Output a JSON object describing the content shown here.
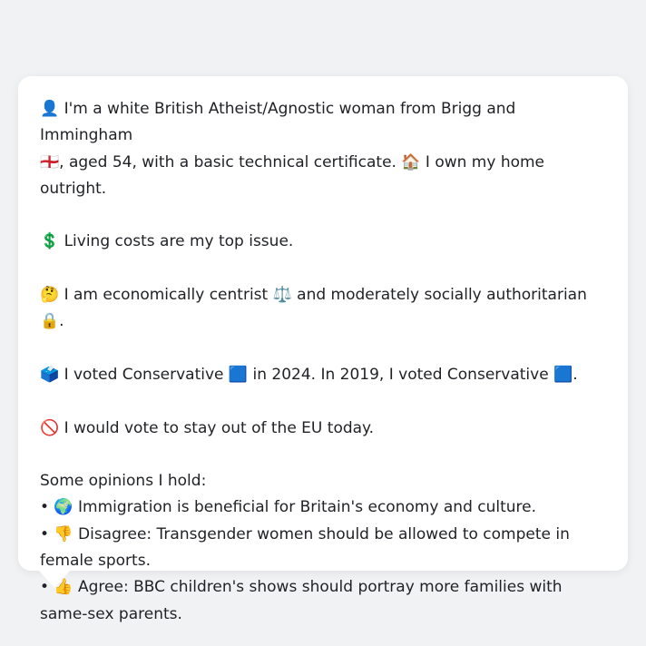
{
  "profile": {
    "intro_line_1": "👤 I'm a white British Atheist/Agnostic woman from Brigg and Immingham",
    "intro_line_2": "🏴󠁧󠁢󠁥󠁮󠁧󠁿, aged 54, with a basic technical certificate. 🏠 I own my home outright.",
    "top_issue": "💲 Living costs are my top issue.",
    "political_stance": "🤔 I am economically centrist ⚖️ and moderately socially authoritarian 🔒.",
    "voting_history": "🗳️ I voted Conservative 🟦 in 2024. In 2019, I voted Conservative 🟦.",
    "eu_stance": "🚫 I would vote to stay out of the EU today.",
    "opinions_heading": "Some opinions I hold:",
    "opinions": [
      "• 🌍 Immigration is beneficial for Britain's economy and culture.",
      "• 👎 Disagree: Transgender women should be allowed to compete in female sports.",
      "• 👍 Agree: BBC children's shows should portray more families with same-sex parents."
    ]
  }
}
